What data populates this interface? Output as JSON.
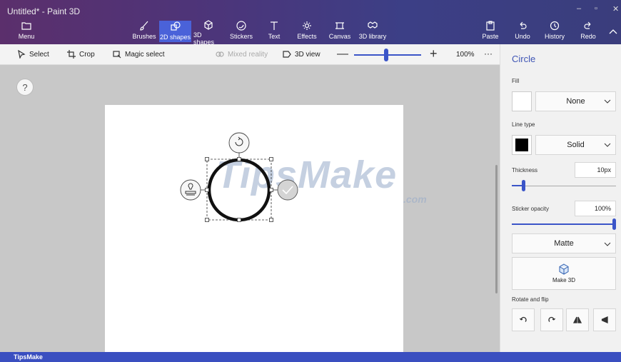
{
  "window": {
    "title": "Untitled* - Paint 3D"
  },
  "ribbon": {
    "menu": "Menu",
    "tools": [
      {
        "label": "Brushes"
      },
      {
        "label": "2D shapes",
        "active": true
      },
      {
        "label": "3D shapes"
      },
      {
        "label": "Stickers"
      },
      {
        "label": "Text"
      },
      {
        "label": "Effects"
      },
      {
        "label": "Canvas"
      },
      {
        "label": "3D library"
      }
    ],
    "paste": "Paste",
    "undo": "Undo",
    "history": "History",
    "redo": "Redo"
  },
  "toolbar": {
    "select": "Select",
    "crop": "Crop",
    "magic_select": "Magic select",
    "mixed_reality": "Mixed reality",
    "view_3d": "3D view",
    "zoom": "100%",
    "zoom_level": 0.48,
    "more": "···"
  },
  "canvas": {
    "help": "?",
    "watermark": "TipsMake",
    "watermark_sub": ".com"
  },
  "panel": {
    "title": "Circle",
    "fill_label": "Fill",
    "fill_value": "None",
    "line_type_label": "Line type",
    "line_type_value": "Solid",
    "line_color": "#000000",
    "thickness_label": "Thickness",
    "thickness_value": "10px",
    "thickness_level": 0.1,
    "opacity_label": "Sticker opacity",
    "opacity_value": "100%",
    "opacity_level": 1.0,
    "finish_value": "Matte",
    "make3d": "Make 3D",
    "rotate_label": "Rotate and flip"
  },
  "footer": {
    "brand": "TipsMake"
  },
  "colors": {
    "accent": "#3b55c8",
    "ribbon_start": "#5b2f6c",
    "ribbon_end": "#3a3d7c"
  }
}
